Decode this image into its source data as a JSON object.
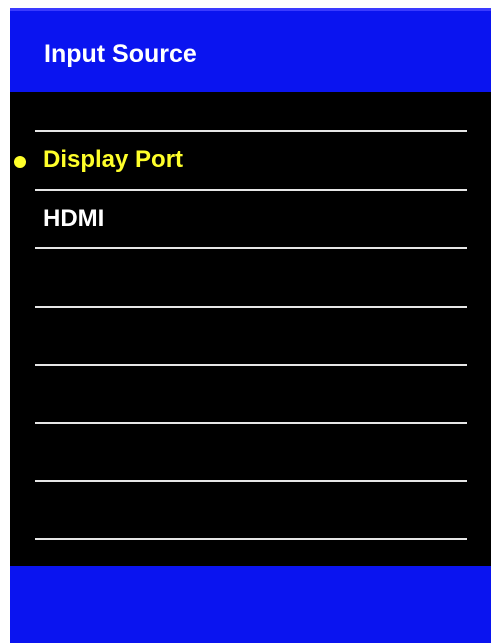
{
  "osd": {
    "title": "Input Source",
    "selected_indicator_icon": "filled-circle-bullet",
    "colors": {
      "header_bg": "#0a14f0",
      "body_bg": "#000000",
      "selected_text": "#ffff2a",
      "text": "#ffffff",
      "separator": "#e6e6e6"
    },
    "items": [
      {
        "label": "Display Port",
        "selected": true
      },
      {
        "label": "HDMI",
        "selected": false
      }
    ]
  }
}
